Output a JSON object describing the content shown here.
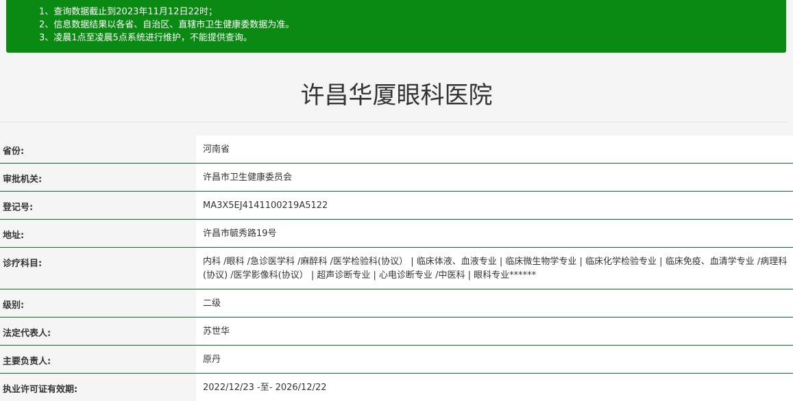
{
  "notice": {
    "lines": [
      "1、查询数据截止到2023年11月12日22时；",
      "2、信息数据结果以各省、自治区、直辖市卫生健康委数据为准。",
      "3、凌晨1点至凌晨5点系统进行维护，不能提供查询。"
    ]
  },
  "hospital": {
    "name": "许昌华厦眼科医院"
  },
  "fields": [
    {
      "label": "省份:",
      "value": "河南省"
    },
    {
      "label": "审批机关:",
      "value": "许昌市卫生健康委员会"
    },
    {
      "label": "登记号:",
      "value": "MA3X5EJ4141100219A5122"
    },
    {
      "label": "地址:",
      "value": "许昌市毓秀路19号"
    },
    {
      "label": "诊疗科目:",
      "value": "内科 /眼科 /急诊医学科 /麻醉科 /医学检验科(协议） | 临床体液、血液专业 | 临床微生物学专业 | 临床化学检验专业 | 临床免疫、血清学专业 /病理科(协议) /医学影像科(协议） | 超声诊断专业 | 心电诊断专业 /中医科 | 眼科专业******"
    },
    {
      "label": "级别:",
      "value": "二级"
    },
    {
      "label": "法定代表人:",
      "value": "苏世华"
    },
    {
      "label": "主要负责人:",
      "value": "原丹"
    },
    {
      "label": "执业许可证有效期:",
      "value": "2022/12/23 -至- 2026/12/22"
    }
  ],
  "colors": {
    "notice_bg": "#0b8a13",
    "row_border": "#0d6b2c"
  }
}
